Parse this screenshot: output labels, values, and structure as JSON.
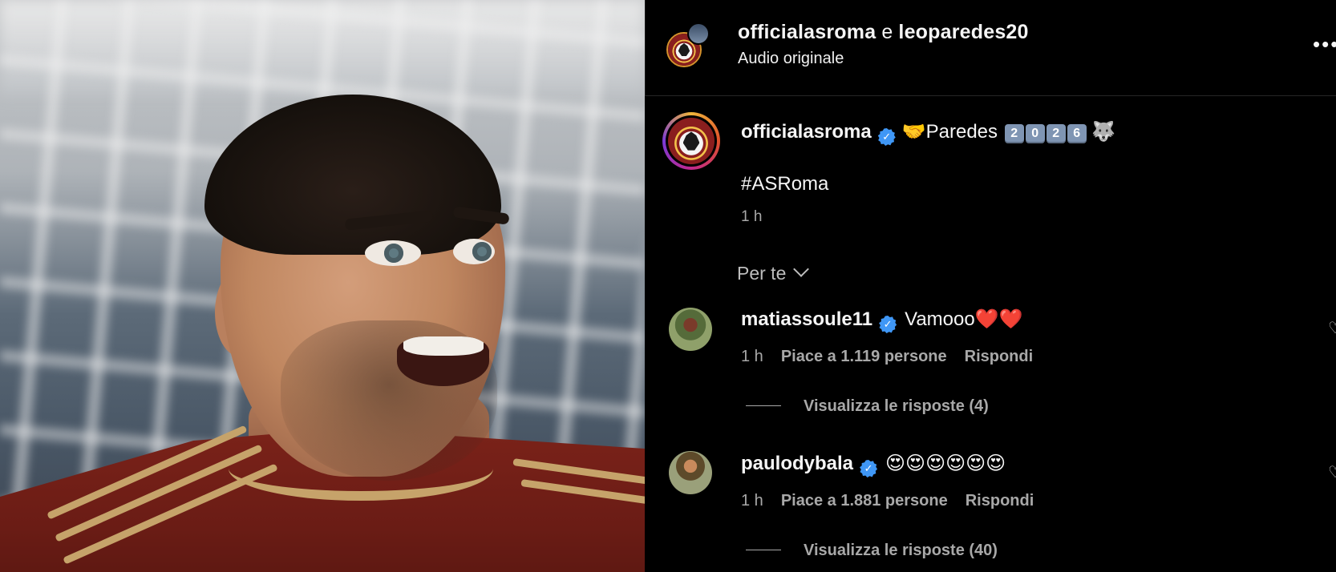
{
  "header": {
    "account1": "officialasroma",
    "join": "e",
    "account2": "leoparedes20",
    "audio": "Audio originale"
  },
  "post": {
    "author": "officialasroma",
    "caption_lead": "🤝Paredes",
    "caption_digits": [
      "2",
      "0",
      "2",
      "6"
    ],
    "caption_tail": "🐺",
    "hashtag": "#ASRoma",
    "time": "1 h"
  },
  "sort": {
    "label": "Per te"
  },
  "comments": [
    {
      "author": "matiassoule11",
      "text": "Vamooo❤️❤️",
      "time": "1 h",
      "likes": "Piace a 1.119 persone",
      "reply": "Rispondi",
      "view_replies": "Visualizza le risposte (4)"
    },
    {
      "author": "paulodybala",
      "text": "😍😍😍😍😍😍",
      "time": "1 h",
      "likes": "Piace a 1.881 persone",
      "reply": "Rispondi",
      "view_replies": "Visualizza le risposte (40)"
    }
  ],
  "icons": {
    "more": "more-options-icon",
    "verified": "verified-badge-icon",
    "like": "heart-icon",
    "expand": "chevron-down-icon"
  },
  "colors": {
    "background": "#000000",
    "verified": "#3f97f6",
    "secondary_text": "#a8a8a8",
    "roma_red": "#8a1e1e",
    "roma_gold": "#f3c24a"
  }
}
